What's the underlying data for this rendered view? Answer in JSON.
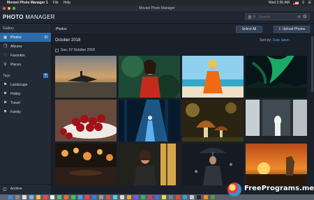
{
  "menubar": {
    "app_name": "Movavi Photo Manager 1",
    "menu_file": "File",
    "menu_help": "Help",
    "clock": "Wed 2:36 AM"
  },
  "window": {
    "title": "Movavi Photo Manager"
  },
  "header": {
    "logo_bold": "PHOTO",
    "logo_rest": " MANAGER",
    "search_placeholder": "Search"
  },
  "sidebar": {
    "section_gallery": "Gallery",
    "items": [
      {
        "label": "Photos",
        "icon": "photo-icon",
        "count": "80",
        "active": true
      },
      {
        "label": "Albums",
        "icon": "album-icon"
      },
      {
        "label": "Favorites",
        "icon": "heart-icon"
      },
      {
        "label": "Places",
        "icon": "pin-icon"
      }
    ],
    "section_tags": "Tags",
    "tags": [
      {
        "label": "Landscape"
      },
      {
        "label": "Hobby"
      },
      {
        "label": "Travel"
      },
      {
        "label": "Family"
      }
    ],
    "archive": "Archive"
  },
  "toolbar": {
    "title": "Photos",
    "select_all": "Select All",
    "upload": "Upload Photos"
  },
  "content": {
    "month": "October 2018",
    "sort_label": "Sort by:",
    "sort_value": "Date taken",
    "day": "Sun, 07 October 2018"
  },
  "watermark": {
    "text": "FreePrograms.me"
  },
  "colors": {
    "accent": "#2d6ca8",
    "sidebar_bg": "#222a36",
    "content_bg": "#1a2029",
    "link": "#5aa0e8"
  }
}
